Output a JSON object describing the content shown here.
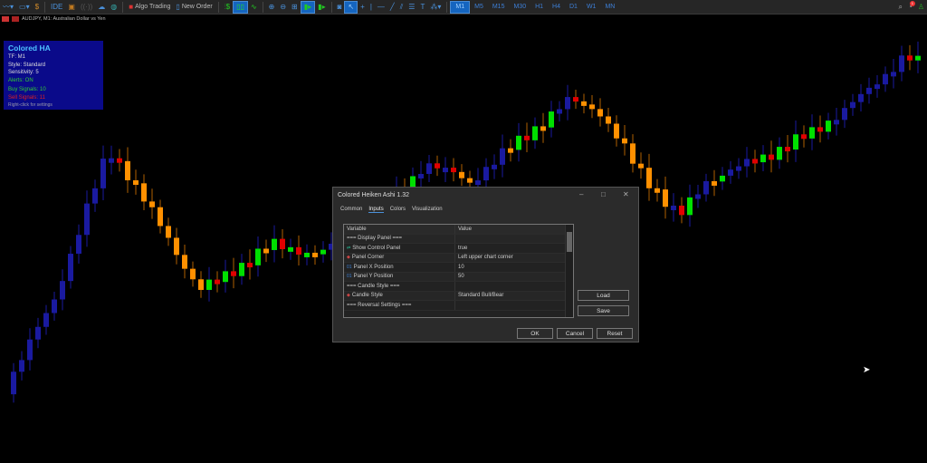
{
  "toolbar": {
    "algo_trading": "Algo Trading",
    "new_order": "New Order",
    "ide": "IDE",
    "timeframes": [
      "M1",
      "M5",
      "M15",
      "M30",
      "H1",
      "H4",
      "D1",
      "W1",
      "MN"
    ],
    "active_timeframe": "M1",
    "notification_count": "1"
  },
  "chart": {
    "symbol_line": "AUDJPY, M1:  Australian Dollar vs Yen",
    "colors": {
      "bull": "#1a1aa0",
      "bear": "#ff9000",
      "buy_signal": "#00e000",
      "sell_signal": "#e00000",
      "wick": "#1a1aa0"
    }
  },
  "panel": {
    "title": "Colored HA",
    "tf": "TF: M1",
    "style": "Style: Standard",
    "sensitivity": "Sensitivity: 5",
    "alerts": "Alerts: ON",
    "buy": "Buy Signals: 10",
    "sell": "Sell Signals: 11",
    "hint": "Right-click for settings"
  },
  "dialog": {
    "title": "Colored Heiken Ashi 1.32",
    "tabs": [
      "Common",
      "Inputs",
      "Colors",
      "Visualization"
    ],
    "active_tab": "Inputs",
    "columns": [
      "Variable",
      "Value"
    ],
    "rows": [
      {
        "icon": "",
        "variable": "=== Display Panel ===",
        "value": ""
      },
      {
        "icon": "bool",
        "variable": "Show Control Panel",
        "value": "true"
      },
      {
        "icon": "enum",
        "variable": "Panel Corner",
        "value": "Left upper chart corner"
      },
      {
        "icon": "int",
        "variable": "Panel X Position",
        "value": "10"
      },
      {
        "icon": "int",
        "variable": "Panel Y Position",
        "value": "50"
      },
      {
        "icon": "",
        "variable": "=== Candle Style ===",
        "value": ""
      },
      {
        "icon": "enum",
        "variable": "Candle Style",
        "value": "Standard Bull/Bear"
      },
      {
        "icon": "",
        "variable": "=== Reversal Settings ===",
        "value": ""
      }
    ],
    "load": "Load",
    "save": "Save",
    "ok": "OK",
    "cancel": "Cancel",
    "reset": "Reset"
  }
}
